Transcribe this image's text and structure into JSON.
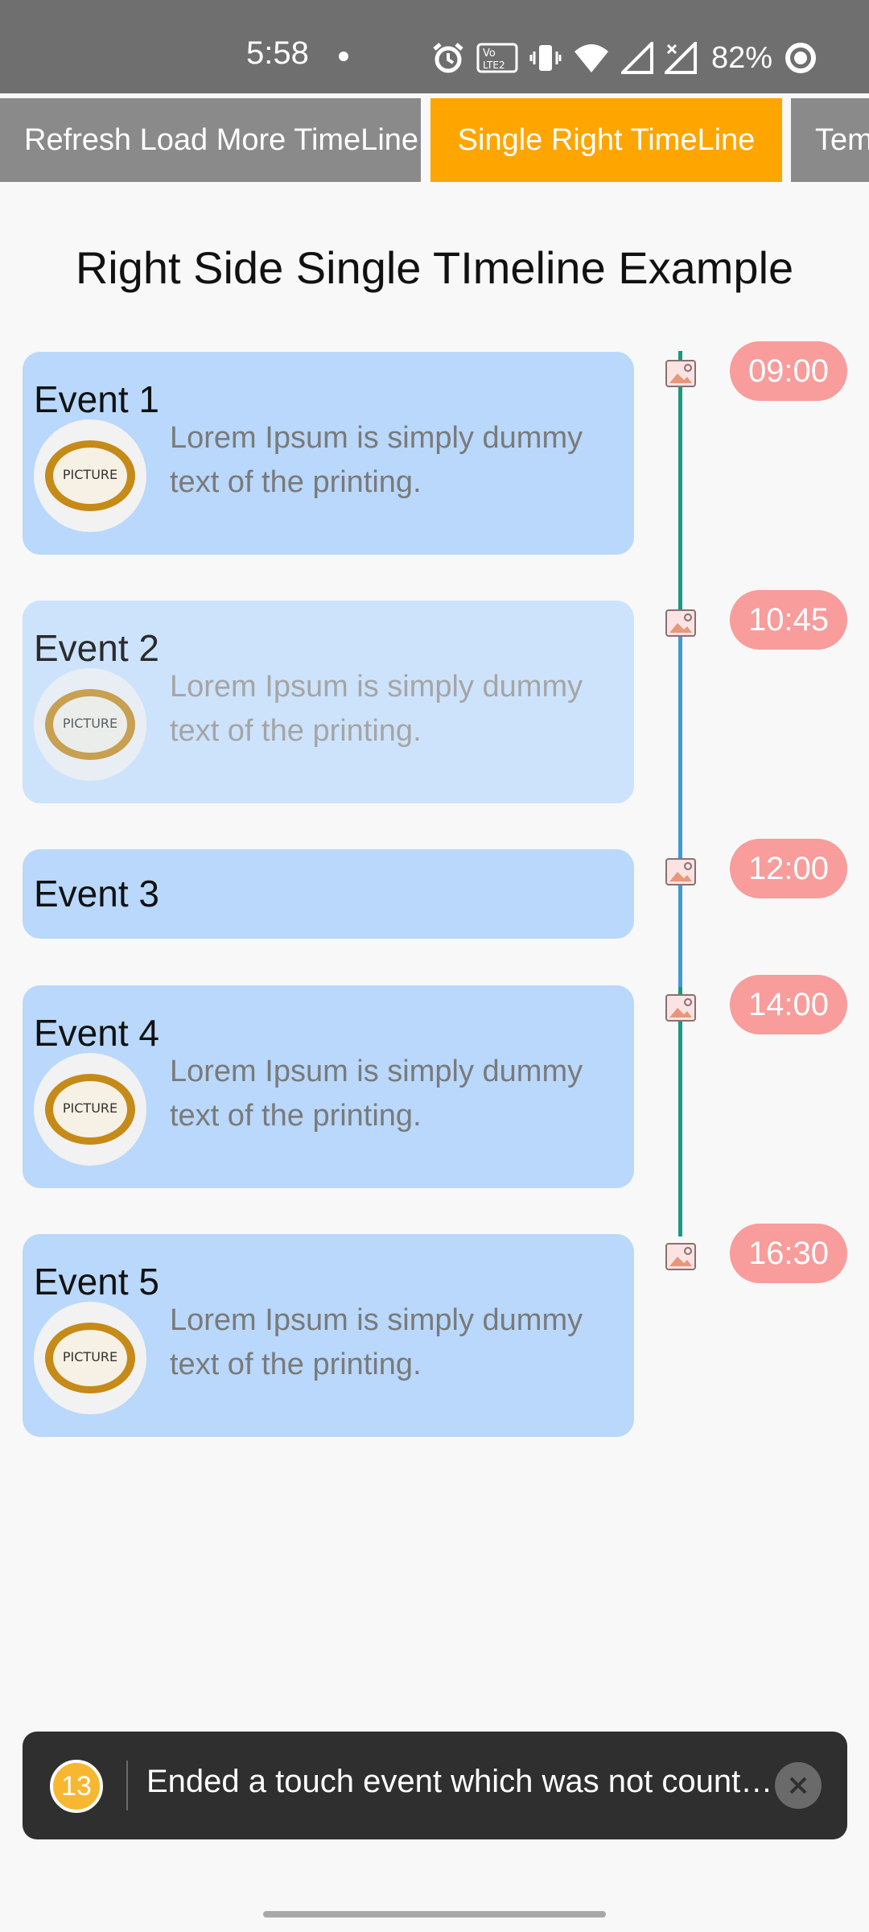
{
  "status_bar": {
    "time": "5:58",
    "battery": "82%",
    "icons": [
      "alarm-icon",
      "volte-icon",
      "vibrate-icon",
      "wifi-icon",
      "signal-icon",
      "signal-x-icon",
      "battery-ring-icon"
    ]
  },
  "tabs": [
    {
      "label": "Refresh Load More TimeLine",
      "selected": false
    },
    {
      "label": "Single Right TimeLine",
      "selected": true
    },
    {
      "label": "Template",
      "selected": false
    }
  ],
  "page_title": "Right Side Single TImeline Example",
  "events": [
    {
      "title": "Event 1",
      "description": "Lorem Ipsum is simply dummy text of the printing.",
      "time": "09:00"
    },
    {
      "title": "Event 2",
      "description": "Lorem Ipsum is simply dummy text of the printing.",
      "time": "10:45"
    },
    {
      "title": "Event 3",
      "description": "",
      "time": "12:00"
    },
    {
      "title": "Event 4",
      "description": "Lorem Ipsum is simply dummy text of the printing.",
      "time": "14:00"
    },
    {
      "title": "Event 5",
      "description": "Lorem Ipsum is simply dummy text of the printing.",
      "time": "16:30"
    }
  ],
  "picture_label": "PICTURE",
  "colors": {
    "tab_selected": "#ffa500",
    "tab_default": "#8a8a8a",
    "card": "#b9d8fb",
    "time_pill": "#f89c9c",
    "line_green": "#1a9a82",
    "line_blue": "#3f9bd2"
  },
  "toast": {
    "count": "13",
    "message": "Ended a touch event which was not counted"
  }
}
